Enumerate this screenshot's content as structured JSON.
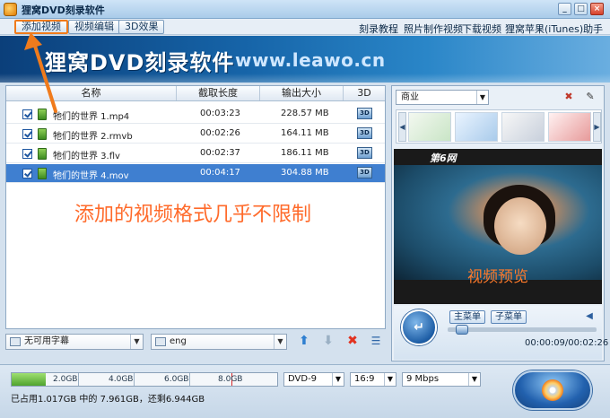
{
  "window": {
    "title": "狸窝DVD刻录软件",
    "controls": [
      "_",
      "□",
      "×"
    ]
  },
  "menubar": {
    "tabs": [
      {
        "label": "添加视频",
        "active": true
      },
      {
        "label": "视频编辑",
        "active": false
      },
      {
        "label": "3D效果",
        "active": false
      }
    ],
    "links": [
      "刻录教程",
      "照片制作视频",
      "下载视频",
      "狸窝苹果(iTunes)助手"
    ]
  },
  "banner": {
    "title": "狸窝DVD刻录软件",
    "url": "www.leawo.cn"
  },
  "file_table": {
    "columns": [
      "名称",
      "截取长度",
      "输出大小",
      "3D"
    ],
    "rows": [
      {
        "name": "牠们的世界 1.mp4",
        "length": "00:03:23",
        "size": "228.57 MB",
        "d3": "3D",
        "checked": true,
        "selected": false
      },
      {
        "name": "牠们的世界 2.rmvb",
        "length": "00:02:26",
        "size": "164.11 MB",
        "d3": "3D",
        "checked": true,
        "selected": false
      },
      {
        "name": "牠们的世界 3.flv",
        "length": "00:02:37",
        "size": "186.11 MB",
        "d3": "3D",
        "checked": true,
        "selected": false
      },
      {
        "name": "牠们的世界 4.mov",
        "length": "00:04:17",
        "size": "304.88 MB",
        "d3": "3D",
        "checked": true,
        "selected": true
      }
    ],
    "overlay_text": "添加的视频格式几乎不限制"
  },
  "table_toolbar": {
    "subtitle_select": "无可用字幕",
    "audio_select": "eng"
  },
  "preview": {
    "theme_select": "商业",
    "video_logo": "第6网",
    "video_caption": "视频预览",
    "main_menu_button": "主菜单",
    "sub_menu_button": "子菜单",
    "time": "00:00:09/00:02:26",
    "progress": 0.06
  },
  "bottom": {
    "capacity_ticks": [
      "2.0GB",
      "4.0GB",
      "6.0GB",
      "8.0GB"
    ],
    "capacity_used_fraction": 0.13,
    "usage_text": "已占用1.017GB 中的 7.961GB，还剩6.944GB",
    "disc_type": "DVD-9",
    "aspect_ratio": "16:9",
    "bitrate": "9 Mbps"
  },
  "colors": {
    "accent_orange": "#f07b1c",
    "selection_blue": "#3f7fd0",
    "banner_blue": "#1664a8"
  }
}
